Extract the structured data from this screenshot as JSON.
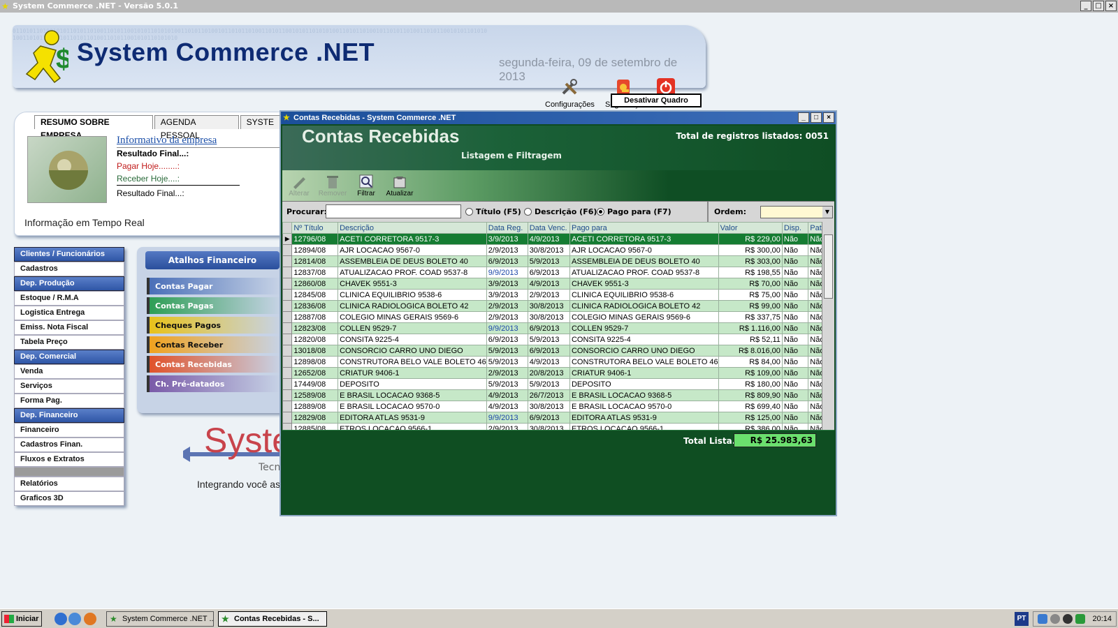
{
  "window": {
    "title": "System Commerce .NET - Versão 5.0.1"
  },
  "header": {
    "logo": "System Commerce .NET",
    "date": "segunda-feira, 09 de setembro de 2013",
    "binary": "0110101101001010110101101001101011001010110101010011010110100101101011010011010110010101101010100110101101001011010110100110101100101011010101001101011010010110101101001101011001010110101010",
    "buttons": [
      {
        "label": "Configurações",
        "icon": "tools-icon"
      },
      {
        "label": "Segurança",
        "icon": "security-icon"
      },
      {
        "label": "Sair",
        "icon": "power-icon"
      }
    ]
  },
  "desativar_label": "Desativar Quadro",
  "info": {
    "tabs": [
      "RESUMO SOBRE EMPRESA",
      "AGENDA PESSOAL",
      "SYSTE"
    ],
    "title": "Informativo da empresa",
    "resultado1": "Resultado Final...:",
    "pagar": "Pagar Hoje........:",
    "receber": "Receber Hoje....:",
    "resultado2": "Resultado Final...:",
    "footer": "Informação em Tempo Real"
  },
  "menu": [
    {
      "label": "Clientes / Funcionários",
      "type": "h"
    },
    {
      "label": "Cadastros",
      "type": "i"
    },
    {
      "label": "Dep. Produção",
      "type": "h"
    },
    {
      "label": "Estoque / R.M.A",
      "type": "i"
    },
    {
      "label": "Logistica Entrega",
      "type": "i"
    },
    {
      "label": "Emiss. Nota Fiscal",
      "type": "i"
    },
    {
      "label": "Tabela Preço",
      "type": "i"
    },
    {
      "label": "Dep. Comercial",
      "type": "h"
    },
    {
      "label": "Venda",
      "type": "i"
    },
    {
      "label": "Serviços",
      "type": "i"
    },
    {
      "label": "Forma Pag.",
      "type": "i"
    },
    {
      "label": "Dep. Financeiro",
      "type": "h"
    },
    {
      "label": "Financeiro",
      "type": "i"
    },
    {
      "label": "Cadastros Finan.",
      "type": "i"
    },
    {
      "label": "Fluxos e Extratos",
      "type": "i"
    },
    {
      "label": "",
      "type": "sep"
    },
    {
      "label": "Relatórios",
      "type": "i"
    },
    {
      "label": "Graficos 3D",
      "type": "i"
    }
  ],
  "atalhos": {
    "title": "Atalhos Financeiro",
    "items": [
      {
        "label": "Contas Pagar",
        "color": "#4a6fb8"
      },
      {
        "label": "Contas Pagas",
        "color": "#2e9e55"
      },
      {
        "label": "Cheques Pagos",
        "color": "#e8c21a"
      },
      {
        "label": "Contas Receber",
        "color": "#f0a21e"
      },
      {
        "label": "Contas Recebidas",
        "color": "#e0522a"
      },
      {
        "label": "Ch. Pré-datados",
        "color": "#7a5aa8"
      }
    ]
  },
  "brand": {
    "big": "Syste",
    "tec": "Tecn",
    "slogan": "Integrando você as"
  },
  "dialog": {
    "title": "Contas Recebidas - System Commerce .NET",
    "banner_title": "Contas Recebidas",
    "banner_sub": "Listagem e Filtragem",
    "total_registros": "Total de registros listados: 0051",
    "toolbar": [
      "Alterar",
      "Remover",
      "Filtrar",
      "Atualizar"
    ],
    "procurar": "Procurar:",
    "radios": [
      "Título (F5)",
      "Descrição (F6)",
      "Pago para (F7)"
    ],
    "ordem": "Ordem:",
    "columns": [
      "Nº Título",
      "Descrição",
      "Data Reg.",
      "Data Venc.",
      "Pago para",
      "Valor",
      "Disp.",
      "Patr."
    ],
    "rows": [
      [
        "12796/08",
        "ACETI CORRETORA 9517-3",
        "3/9/2013",
        "4/9/2013",
        "ACETI CORRETORA 9517-3",
        "R$ 229,00",
        "Não",
        "Não"
      ],
      [
        "12894/08",
        "AJR LOCACAO 9567-0",
        "2/9/2013",
        "30/8/2013",
        "AJR LOCACAO 9567-0",
        "R$ 300,00",
        "Não",
        "Não"
      ],
      [
        "12814/08",
        "ASSEMBLEIA DE DEUS BOLETO 40",
        "6/9/2013",
        "5/9/2013",
        "ASSEMBLEIA DE DEUS BOLETO 40",
        "R$ 303,00",
        "Não",
        "Não"
      ],
      [
        "12837/08",
        "ATUALIZACAO PROF. COAD 9537-8",
        "9/9/2013",
        "6/9/2013",
        "ATUALIZACAO PROF. COAD 9537-8",
        "R$ 198,55",
        "Não",
        "Não"
      ],
      [
        "12860/08",
        "CHAVEK 9551-3",
        "3/9/2013",
        "4/9/2013",
        "CHAVEK 9551-3",
        "R$ 70,00",
        "Não",
        "Não"
      ],
      [
        "12845/08",
        "CLINICA EQUILIBRIO 9538-6",
        "3/9/2013",
        "2/9/2013",
        "CLINICA EQUILIBRIO 9538-6",
        "R$ 75,00",
        "Não",
        "Não"
      ],
      [
        "12836/08",
        "CLINICA RADIOLOGICA BOLETO 42",
        "2/9/2013",
        "30/8/2013",
        "CLINICA RADIOLOGICA BOLETO 42",
        "R$ 99,00",
        "Não",
        "Não"
      ],
      [
        "12887/08",
        "COLEGIO MINAS GERAIS 9569-6",
        "2/9/2013",
        "30/8/2013",
        "COLEGIO MINAS GERAIS 9569-6",
        "R$ 337,75",
        "Não",
        "Não"
      ],
      [
        "12823/08",
        "COLLEN 9529-7",
        "9/9/2013",
        "6/9/2013",
        "COLLEN 9529-7",
        "R$ 1.116,00",
        "Não",
        "Não"
      ],
      [
        "12820/08",
        "CONSITA 9225-4",
        "6/9/2013",
        "5/9/2013",
        "CONSITA 9225-4",
        "R$ 52,11",
        "Não",
        "Não"
      ],
      [
        "13018/08",
        "CONSORCIO CARRO UNO DIEGO",
        "5/9/2013",
        "6/9/2013",
        "CONSORCIO CARRO UNO DIEGO",
        "R$ 8.016,00",
        "Não",
        "Não"
      ],
      [
        "12898/08",
        "CONSTRUTORA BELO VALE BOLETO 46",
        "5/9/2013",
        "4/9/2013",
        "CONSTRUTORA BELO VALE BOLETO 46",
        "R$ 84,00",
        "Não",
        "Não"
      ],
      [
        "12652/08",
        "CRIATUR 9406-1",
        "2/9/2013",
        "20/8/2013",
        "CRIATUR 9406-1",
        "R$ 109,00",
        "Não",
        "Não"
      ],
      [
        "17449/08",
        "DEPOSITO",
        "5/9/2013",
        "5/9/2013",
        "DEPOSITO",
        "R$ 180,00",
        "Não",
        "Não"
      ],
      [
        "12589/08",
        "E BRASIL LOCACAO 9368-5",
        "4/9/2013",
        "26/7/2013",
        "E BRASIL LOCACAO 9368-5",
        "R$ 809,90",
        "Não",
        "Não"
      ],
      [
        "12889/08",
        "E BRASIL LOCACAO 9570-0",
        "4/9/2013",
        "30/8/2013",
        "E BRASIL LOCACAO 9570-0",
        "R$ 699,40",
        "Não",
        "Não"
      ],
      [
        "12829/08",
        "EDITORA ATLAS 9531-9",
        "9/9/2013",
        "6/9/2013",
        "EDITORA ATLAS 9531-9",
        "R$ 125,00",
        "Não",
        "Não"
      ],
      [
        "12885/08",
        "ETROS LOCACAO 9566-1",
        "2/9/2013",
        "30/8/2013",
        "ETROS LOCACAO 9566-1",
        "R$ 386,00",
        "Não",
        "Não"
      ]
    ],
    "total_label": "Total Lista.:",
    "total_value": "R$ 25.983,63"
  },
  "taskbar": {
    "start": "Iniciar",
    "tasks": [
      "System Commerce .NET ...",
      "Contas Recebidas - S..."
    ],
    "lang": "PT",
    "clock": "20:14"
  }
}
